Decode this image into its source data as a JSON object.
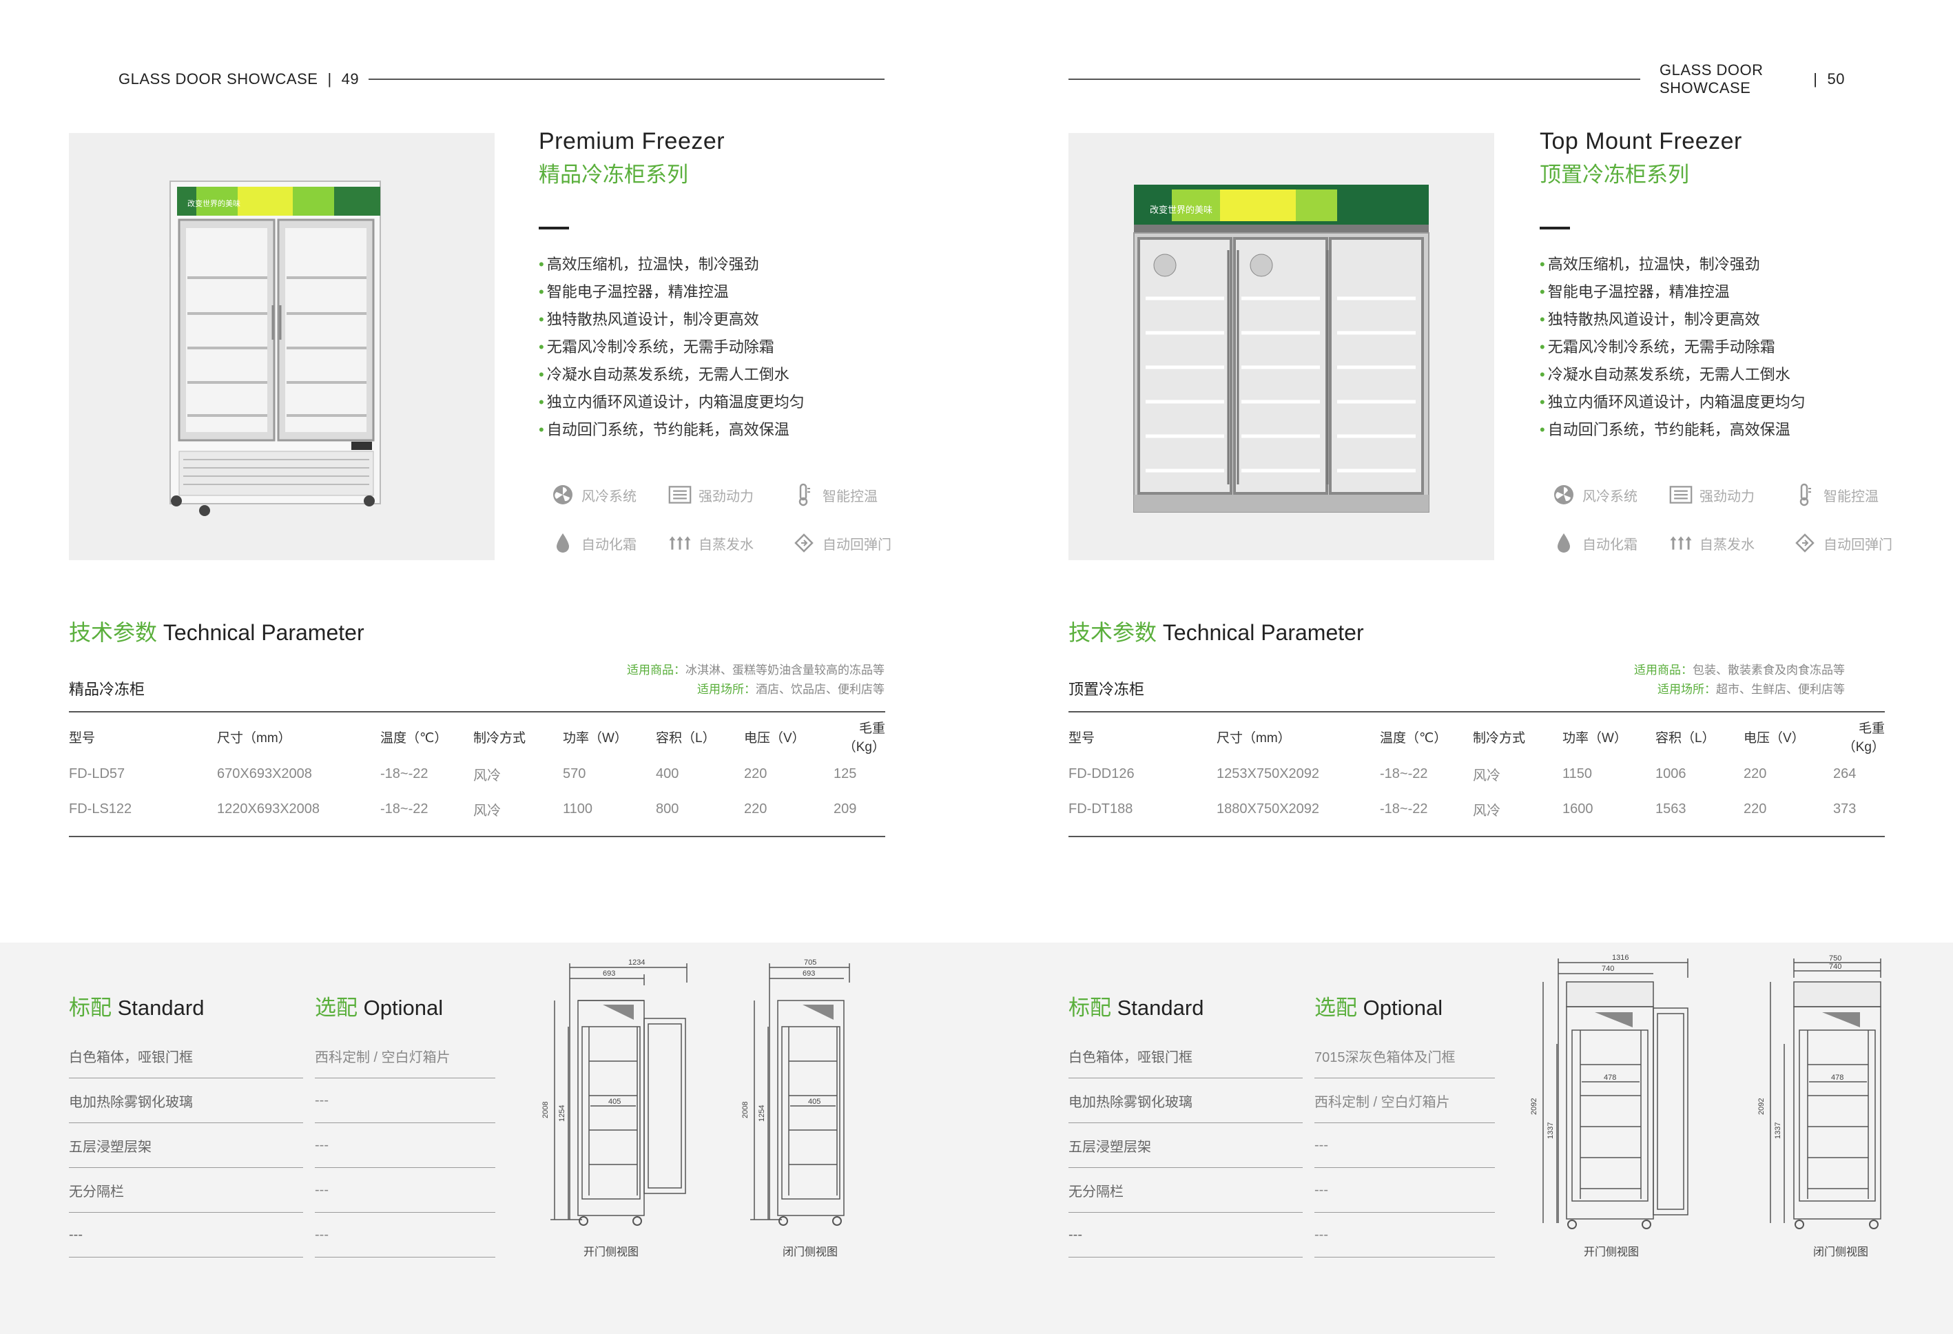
{
  "left": {
    "running_head": "GLASS DOOR SHOWCASE",
    "page_number": "49",
    "title_en": "Premium Freezer",
    "title_cn": "精品冷冻柜系列",
    "photo_banner_text": "改变世界的美味",
    "features": [
      "高效压缩机，拉温快，制冷强劲",
      "智能电子温控器，精准控温",
      "独特散热风道设计，制冷更高效",
      "无霜风冷制冷系统，无需手动除霜",
      "冷凝水自动蒸发系统，无需人工倒水",
      "独立内循环风道设计，内箱温度更均匀",
      "自动回门系统，节约能耗，高效保温"
    ],
    "icons": [
      {
        "name": "fan-icon",
        "label": "风冷系统"
      },
      {
        "name": "power-icon",
        "label": "强劲动力"
      },
      {
        "name": "thermometer-icon",
        "label": "智能控温"
      },
      {
        "name": "droplet-icon",
        "label": "自动化霜"
      },
      {
        "name": "evaporation-icon",
        "label": "自蒸发水"
      },
      {
        "name": "door-return-icon",
        "label": "自动回弹门"
      }
    ],
    "param_cn": "技术参数",
    "param_en": "Technical Parameter",
    "model_name": "精品冷冻柜",
    "suit_goods_key": "适用商品：",
    "suit_goods_val": "冰淇淋、蛋糕等奶油含量较高的冻品等",
    "suit_place_key": "适用场所：",
    "suit_place_val": "酒店、饮品店、便利店等",
    "table_headers": [
      "型号",
      "尺寸（mm）",
      "温度（℃）",
      "制冷方式",
      "功率（W）",
      "容积（L）",
      "电压（V）",
      "毛重（Kg）"
    ],
    "table_rows": [
      [
        "FD-LD57",
        "670X693X2008",
        "-18~-22",
        "风冷",
        "570",
        "400",
        "220",
        "125"
      ],
      [
        "FD-LS122",
        "1220X693X2008",
        "-18~-22",
        "风冷",
        "1100",
        "800",
        "220",
        "209"
      ]
    ],
    "standard_cn": "标配",
    "standard_en": "Standard",
    "optional_cn": "选配",
    "optional_en": "Optional",
    "standard_items": [
      "白色箱体，哑银门框",
      "电加热除雾钢化玻璃",
      "五层浸塑层架",
      "无分隔栏",
      "---"
    ],
    "optional_items": [
      "西科定制 / 空白灯箱片",
      "---",
      "---",
      "---",
      "---"
    ],
    "drawing1": {
      "caption": "开门侧视图",
      "dims": [
        "1234",
        "693",
        "2008",
        "1254",
        "405"
      ]
    },
    "drawing2": {
      "caption": "闭门侧视图",
      "dims": [
        "705",
        "693",
        "2008",
        "1254",
        "405"
      ]
    }
  },
  "right": {
    "running_head": "GLASS DOOR SHOWCASE",
    "page_number": "50",
    "title_en": "Top Mount Freezer",
    "title_cn": "顶置冷冻柜系列",
    "photo_banner_text": "改变世界的美味",
    "features": [
      "高效压缩机，拉温快，制冷强劲",
      "智能电子温控器，精准控温",
      "独特散热风道设计，制冷更高效",
      "无霜风冷制冷系统，无需手动除霜",
      "冷凝水自动蒸发系统，无需人工倒水",
      "独立内循环风道设计，内箱温度更均匀",
      "自动回门系统，节约能耗，高效保温"
    ],
    "icons": [
      {
        "name": "fan-icon",
        "label": "风冷系统"
      },
      {
        "name": "power-icon",
        "label": "强劲动力"
      },
      {
        "name": "thermometer-icon",
        "label": "智能控温"
      },
      {
        "name": "droplet-icon",
        "label": "自动化霜"
      },
      {
        "name": "evaporation-icon",
        "label": "自蒸发水"
      },
      {
        "name": "door-return-icon",
        "label": "自动回弹门"
      }
    ],
    "param_cn": "技术参数",
    "param_en": "Technical Parameter",
    "model_name": "顶置冷冻柜",
    "suit_goods_key": "适用商品：",
    "suit_goods_val": "包装、散装素食及肉食冻品等",
    "suit_place_key": "适用场所：",
    "suit_place_val": "超市、生鲜店、便利店等",
    "table_headers": [
      "型号",
      "尺寸（mm）",
      "温度（℃）",
      "制冷方式",
      "功率（W）",
      "容积（L）",
      "电压（V）",
      "毛重（Kg）"
    ],
    "table_rows": [
      [
        "FD-DD126",
        "1253X750X2092",
        "-18~-22",
        "风冷",
        "1150",
        "1006",
        "220",
        "264"
      ],
      [
        "FD-DT188",
        "1880X750X2092",
        "-18~-22",
        "风冷",
        "1600",
        "1563",
        "220",
        "373"
      ]
    ],
    "standard_cn": "标配",
    "standard_en": "Standard",
    "optional_cn": "选配",
    "optional_en": "Optional",
    "standard_items": [
      "白色箱体，哑银门框",
      "电加热除雾钢化玻璃",
      "五层浸塑层架",
      "无分隔栏",
      "---"
    ],
    "optional_items": [
      "7015深灰色箱体及门框",
      "西科定制 / 空白灯箱片",
      "---",
      "---",
      "---"
    ],
    "drawing1": {
      "caption": "开门侧视图",
      "dims": [
        "1316",
        "740",
        "2092",
        "1337",
        "478"
      ]
    },
    "drawing2": {
      "caption": "闭门侧视图",
      "dims": [
        "750",
        "740",
        "2092",
        "1337",
        "478"
      ]
    }
  },
  "colors": {
    "accent_green": "#5aaf3c",
    "text_dark": "#222222",
    "text_grey": "#888888",
    "band_bg": "#f3f3f3"
  }
}
